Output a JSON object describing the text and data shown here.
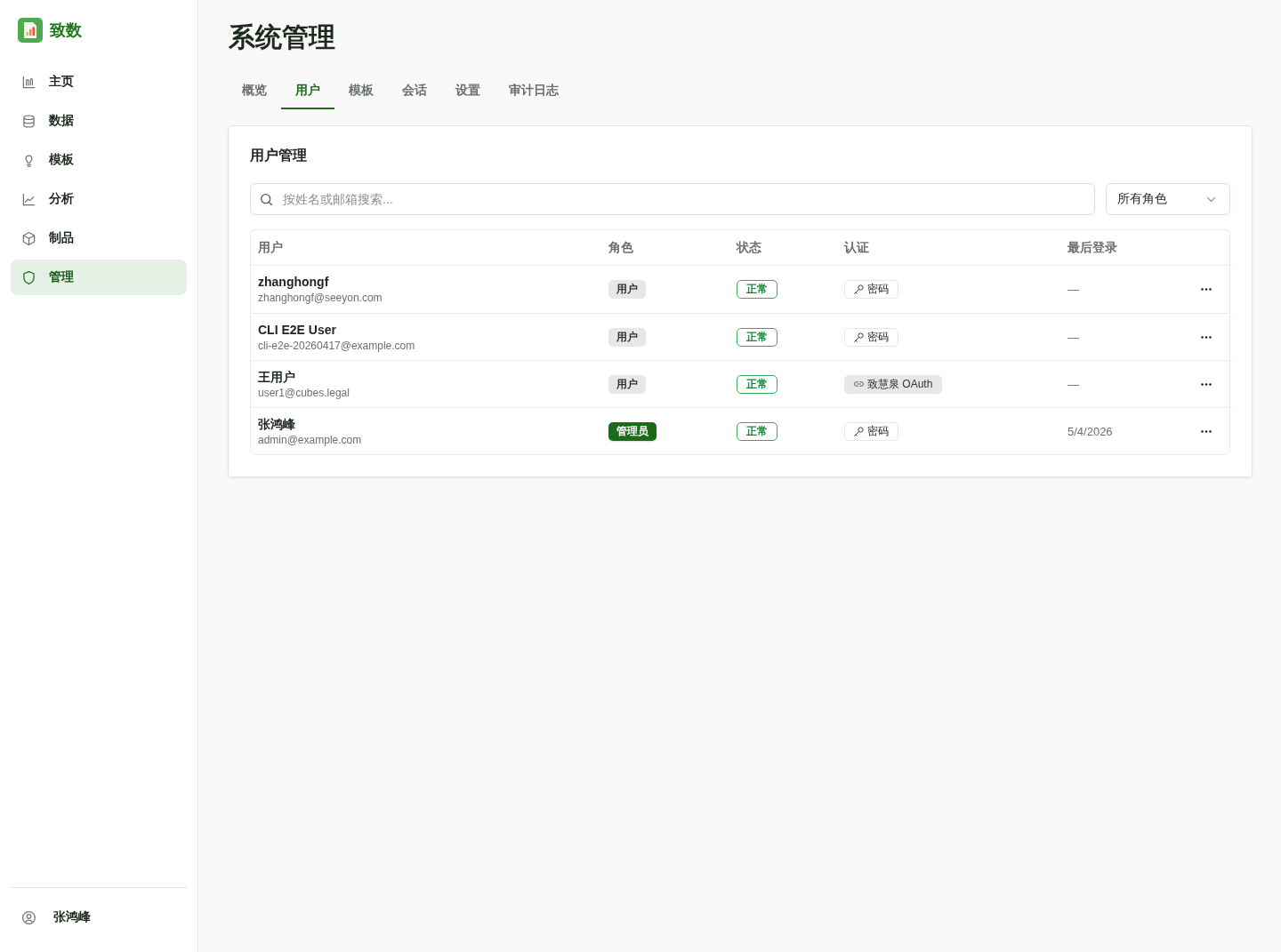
{
  "sidebar": {
    "brand": "致数",
    "items": [
      {
        "label": "主页",
        "selected": false
      },
      {
        "label": "数据",
        "selected": false
      },
      {
        "label": "模板",
        "selected": false
      },
      {
        "label": "分析",
        "selected": false
      },
      {
        "label": "制品",
        "selected": false
      },
      {
        "label": "管理",
        "selected": true
      }
    ],
    "user": {
      "name": "张鸿峰"
    }
  },
  "page_title": "系统管理",
  "tabs": [
    {
      "label": "概览",
      "selected": false
    },
    {
      "label": "用户",
      "selected": true
    },
    {
      "label": "模板",
      "selected": false
    },
    {
      "label": "会话",
      "selected": false
    },
    {
      "label": "设置",
      "selected": false
    },
    {
      "label": "审计日志",
      "selected": false
    }
  ],
  "user_panel": {
    "title": "用户管理",
    "search": {
      "placeholder": "按姓名或邮箱搜索..."
    },
    "role_filter": {
      "value": "所有角色"
    },
    "table": {
      "columns": [
        "用户",
        "角色",
        "状态",
        "认证",
        "最后登录"
      ],
      "rows": [
        {
          "name": "zhanghongf",
          "email": "zhanghongf@seeyon.com",
          "role": {
            "label": "用户",
            "kind": "user"
          },
          "status": {
            "label": "正常",
            "kind": "active"
          },
          "auth": {
            "label": "密码",
            "kind": "password"
          },
          "last_login": "—"
        },
        {
          "name": "CLI E2E User",
          "email": "cli-e2e-20260417@example.com",
          "role": {
            "label": "用户",
            "kind": "user"
          },
          "status": {
            "label": "正常",
            "kind": "active"
          },
          "auth": {
            "label": "密码",
            "kind": "password"
          },
          "last_login": "—"
        },
        {
          "name": "王用户",
          "email": "user1@cubes.legal",
          "role": {
            "label": "用户",
            "kind": "user"
          },
          "status": {
            "label": "正常",
            "kind": "active"
          },
          "auth": {
            "label": "致慧泉 OAuth",
            "kind": "oauth"
          },
          "last_login": "—"
        },
        {
          "name": "张鸿峰",
          "email": "admin@example.com",
          "role": {
            "label": "管理员",
            "kind": "admin"
          },
          "status": {
            "label": "正常",
            "kind": "active"
          },
          "auth": {
            "label": "密码",
            "kind": "password"
          },
          "last_login": "5/4/2026"
        }
      ]
    }
  }
}
